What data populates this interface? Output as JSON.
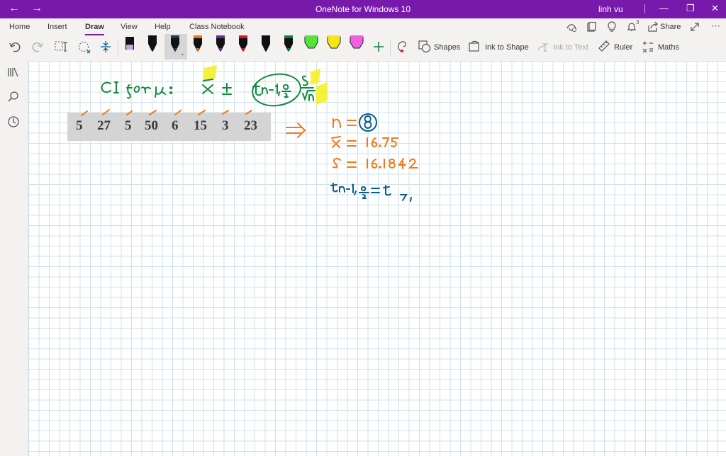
{
  "titlebar": {
    "app_title": "OneNote for Windows 10",
    "user": "linh vu",
    "back_glyph": "←",
    "forward_glyph": "→",
    "minimize_glyph": "—",
    "restore_glyph": "❐",
    "close_glyph": "✕",
    "accent_color": "#7719aa"
  },
  "ribbon": {
    "tabs": [
      "Home",
      "Insert",
      "Draw",
      "View",
      "Help",
      "Class Notebook"
    ],
    "active_tab": "Draw",
    "share_label": "Share",
    "notification_count": "3",
    "tools": {
      "shapes": "Shapes",
      "ink_to_shape": "Ink to Shape",
      "ink_to_text": "Ink to Text",
      "ruler": "Ruler",
      "maths": "Maths"
    },
    "pens": [
      {
        "name": "pen-lilac",
        "color": "#c8a2d8"
      },
      {
        "name": "pen-black",
        "color": "#111111"
      },
      {
        "name": "pen-navy",
        "color": "#0f3d66",
        "selected": true
      },
      {
        "name": "pen-orange",
        "color": "#e8701a"
      },
      {
        "name": "pen-purple",
        "color": "#6f2c91"
      },
      {
        "name": "pen-red",
        "color": "#e81123"
      },
      {
        "name": "pen-black-2",
        "color": "#111111"
      },
      {
        "name": "pen-green",
        "color": "#107c41"
      },
      {
        "name": "highlighter-green",
        "color": "#55e33a"
      },
      {
        "name": "highlighter-yellow",
        "color": "#f5e61a"
      },
      {
        "name": "highlighter-magenta",
        "color": "#f060e0"
      }
    ]
  },
  "data_strip": {
    "values": [
      "5",
      "27",
      "5",
      "50",
      "6",
      "15",
      "3",
      "23"
    ]
  },
  "ink_notes": {
    "formula_prefix": "CI for μ :",
    "formula": "x̄ ± t n-1, α/2 · s/√n",
    "implies": "⇒",
    "n_line": "n = 8",
    "xbar_line": "x̄ = 16.75",
    "s_line": "s = 16.1842",
    "t_line": "t n-1, α/2 = t 7,",
    "green": "#118a3c",
    "navy": "#0b5a8c",
    "orange": "#ef7a1a",
    "highlight": "#f3f01a"
  }
}
